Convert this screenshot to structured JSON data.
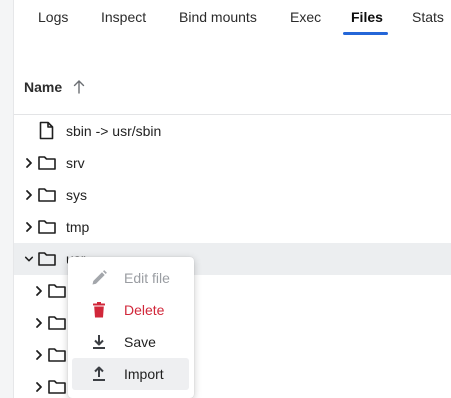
{
  "tabs": [
    {
      "label": "Logs",
      "active": false
    },
    {
      "label": "Inspect",
      "active": false
    },
    {
      "label": "Bind mounts",
      "active": false
    },
    {
      "label": "Exec",
      "active": false
    },
    {
      "label": "Files",
      "active": true
    },
    {
      "label": "Stats",
      "active": false
    }
  ],
  "table": {
    "column_name": "Name",
    "sort": "ascending",
    "rows": [
      {
        "type": "file",
        "name": "sbin -> usr/sbin"
      },
      {
        "type": "folder",
        "name": "srv",
        "expanded": false
      },
      {
        "type": "folder",
        "name": "sys",
        "expanded": false
      },
      {
        "type": "folder",
        "name": "tmp",
        "expanded": false
      },
      {
        "type": "folder",
        "name": "usr",
        "expanded": true,
        "selected": true
      }
    ]
  },
  "context_menu": {
    "items": [
      {
        "label": "Edit file",
        "icon": "pencil-icon",
        "state": "disabled"
      },
      {
        "label": "Delete",
        "icon": "trash-icon",
        "state": "danger"
      },
      {
        "label": "Save",
        "icon": "download-icon",
        "state": "normal"
      },
      {
        "label": "Import",
        "icon": "upload-icon",
        "state": "hovered"
      }
    ]
  },
  "colors": {
    "accent": "#2466d8",
    "danger": "#d1273a",
    "selected_row": "#eceef0"
  }
}
